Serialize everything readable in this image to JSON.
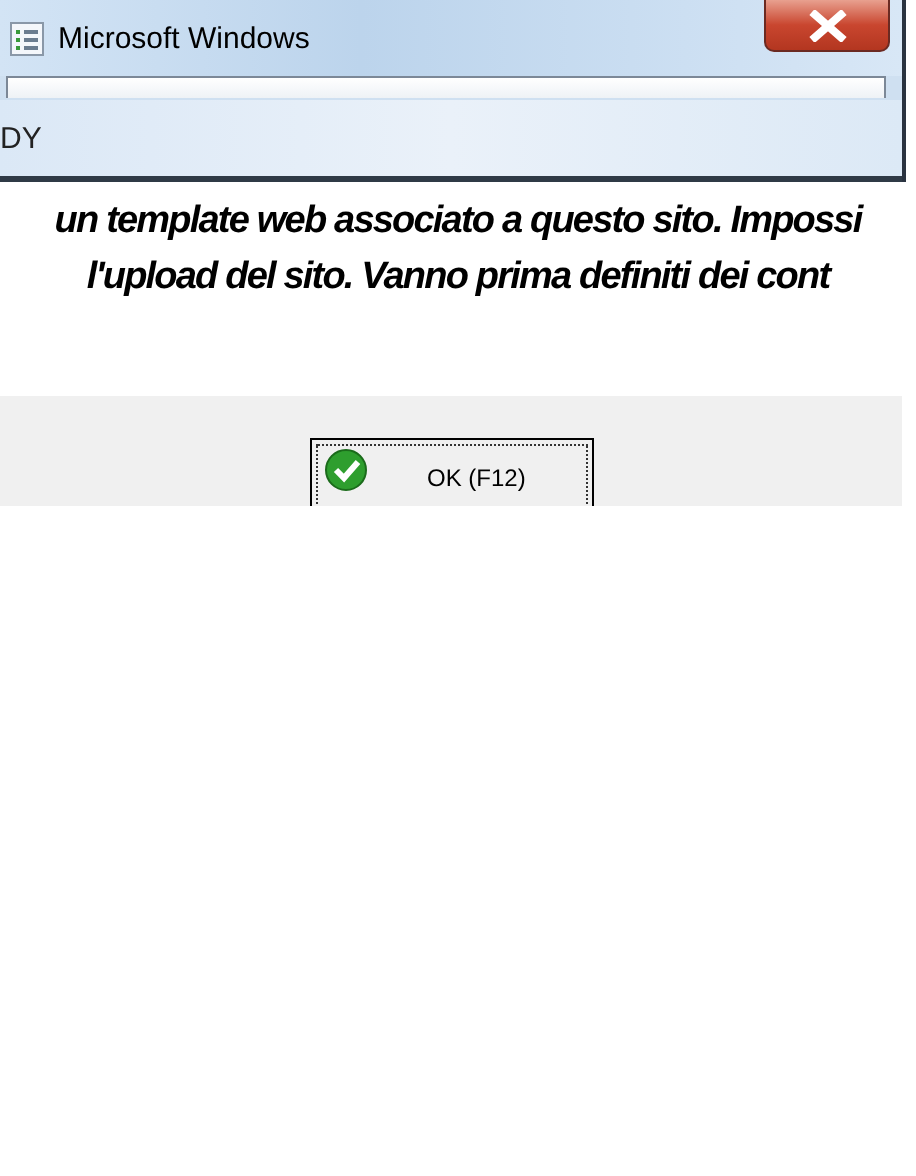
{
  "window": {
    "title": "Microsoft Windows"
  },
  "background_text": "DY",
  "message_lines": [
    "un template web associato a questo sito. Impossi",
    "l'upload del sito. Vanno prima definiti dei cont"
  ],
  "buttons": [
    {
      "label": "OK (F12)",
      "kind": "ok"
    }
  ]
}
